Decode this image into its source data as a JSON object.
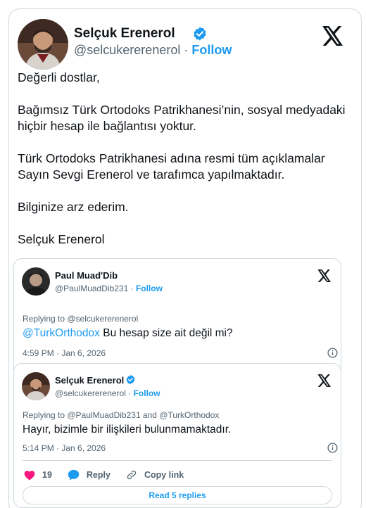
{
  "main_tweet": {
    "author_name": "Selçuk Erenerol",
    "author_handle": "@selcukererenerol",
    "separator": "·",
    "follow_label": "Follow",
    "paragraphs": [
      "Değerli dostlar,",
      "Bağımsız Türk Ortodoks Patrikhanesi’nin, sosyal medyadaki hiçbir hesap ile bağlantısı yoktur.",
      "Türk Ortodoks Patrikhanesi adına resmi tüm açıklamalar Sayın Sevgi Erenerol ve tarafımca yapılmaktadır.",
      "Bilginize arz ederim.",
      "Selçuk Erenerol"
    ]
  },
  "quoted_tweet": {
    "author_name": "Paul Muad'Dib",
    "author_handle": "@PaulMuadDib231",
    "separator": "·",
    "follow_label": "Follow",
    "replying_to": "Replying to @selcukererenerol",
    "mention": "@TurkOrthodox",
    "text": " Bu hesap size ait değil mi?",
    "timestamp": "4:59 PM · Jan 6, 2026"
  },
  "reply_tweet": {
    "author_name": "Selçuk Erenerol",
    "author_handle": "@selcukererenerol",
    "separator": "·",
    "follow_label": "Follow",
    "replying_to": "Replying to @PaulMuadDib231 and @TurkOrthodox",
    "text": "Hayır, bizimle bir ilişkileri bulunmamaktadır.",
    "timestamp": "5:14 PM · Jan 6, 2026",
    "like_count": "19",
    "reply_label": "Reply",
    "copy_link_label": "Copy link",
    "read_replies_label": "Read 5 replies"
  },
  "colors": {
    "accent": "#1d9bf0",
    "text": "#0f1419",
    "muted": "#536471",
    "border": "#cfd9de",
    "like": "#f91880"
  },
  "icons": [
    "x-logo-icon",
    "verified-badge-icon",
    "info-icon",
    "heart-icon",
    "reply-bubble-icon",
    "link-icon"
  ]
}
